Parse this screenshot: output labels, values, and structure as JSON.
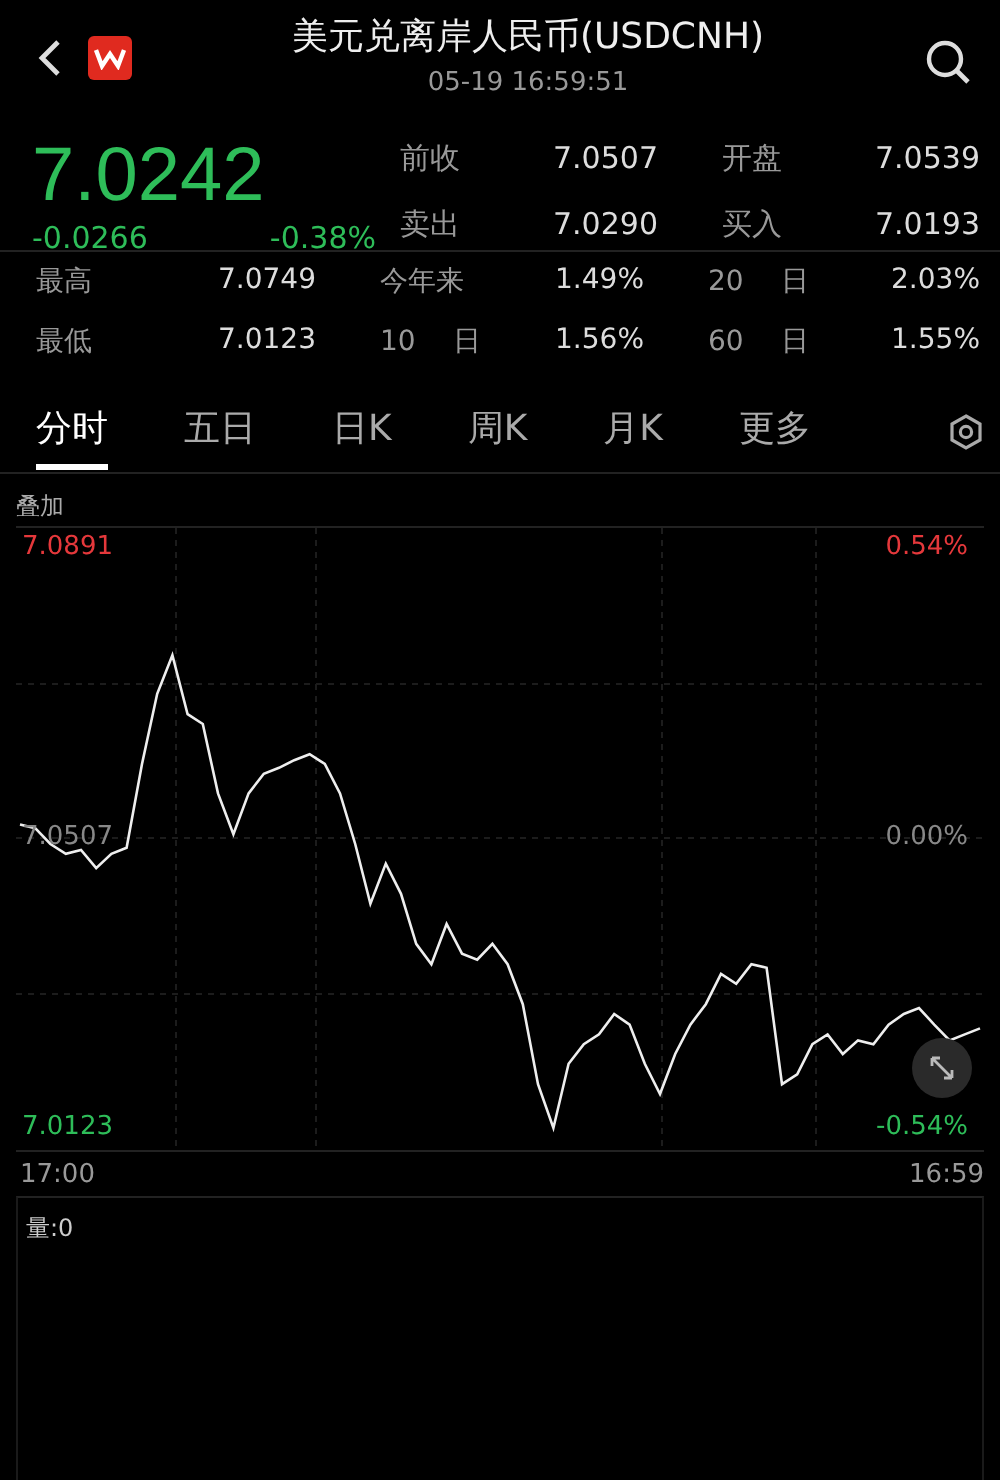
{
  "header": {
    "title": "美元兑离岸人民币(USDCNH)",
    "time": "05-19 16:59:51"
  },
  "quote": {
    "price": "7.0242",
    "change": "-0.0266",
    "change_pct": "-0.38%",
    "color": "#2ebd59"
  },
  "top_stats": [
    {
      "label": "前收",
      "value": "7.0507"
    },
    {
      "label": "开盘",
      "value": "7.0539"
    },
    {
      "label": "卖出",
      "value": "7.0290"
    },
    {
      "label": "买入",
      "value": "7.0193"
    }
  ],
  "range_stats": [
    {
      "label": "最高",
      "value": "7.0749"
    },
    {
      "label": "今年来",
      "value": "1.49%"
    },
    {
      "label": "20 日",
      "value": "2.03%"
    },
    {
      "label": "最低",
      "value": "7.0123"
    },
    {
      "label": "10 日",
      "value": "1.56%"
    },
    {
      "label": "60 日",
      "value": "1.55%"
    }
  ],
  "tabs": [
    {
      "label": "分时",
      "selected": true
    },
    {
      "label": "五日",
      "selected": false
    },
    {
      "label": "日K",
      "selected": false
    },
    {
      "label": "周K",
      "selected": false
    },
    {
      "label": "月K",
      "selected": false
    },
    {
      "label": "更多",
      "selected": false
    }
  ],
  "chart": {
    "overlay_label": "叠加",
    "axis_labels": [
      {
        "pct": "0.54%",
        "color": "#e5383b"
      },
      {
        "pct": "0.00%",
        "color": "#888888"
      },
      {
        "pct": "-0.54%",
        "color": "#2ebd59"
      }
    ],
    "start_time": "17:00",
    "end_time": "16:59",
    "chart_data": {
      "type": "line",
      "grid": true,
      "ylim": [
        7.0123,
        7.0891
      ],
      "yticks": [
        {
          "value": 7.0891,
          "label": "7.0891"
        },
        {
          "value": 7.0507,
          "label": "7.0507"
        },
        {
          "value": 7.0123,
          "label": "7.0123"
        }
      ],
      "series": [
        {
          "color": "#eeeeee",
          "values": [
            7.0525,
            7.052,
            7.0499,
            7.0486,
            7.0491,
            7.0467,
            7.0486,
            7.0494,
            7.0605,
            7.0698,
            7.0749,
            7.0671,
            7.0658,
            7.0566,
            7.0512,
            7.0566,
            7.0592,
            7.06,
            7.061,
            7.0618,
            7.0605,
            7.0566,
            7.0499,
            7.042,
            7.0473,
            7.0433,
            7.0367,
            7.034,
            7.0393,
            7.0354,
            7.0346,
            7.0367,
            7.034,
            7.0287,
            7.0181,
            7.0123,
            7.0208,
            7.0234,
            7.0247,
            7.0274,
            7.026,
            7.0208,
            7.0168,
            7.0221,
            7.026,
            7.0287,
            7.0327,
            7.0314,
            7.034,
            7.0335,
            7.0181,
            7.0194,
            7.0234,
            7.0247,
            7.0221,
            7.0239,
            7.0234,
            7.026,
            7.0274,
            7.0282,
            7.026,
            7.0239,
            7.0247,
            7.0255
          ]
        }
      ]
    }
  },
  "volume": {
    "label": "量:0"
  }
}
